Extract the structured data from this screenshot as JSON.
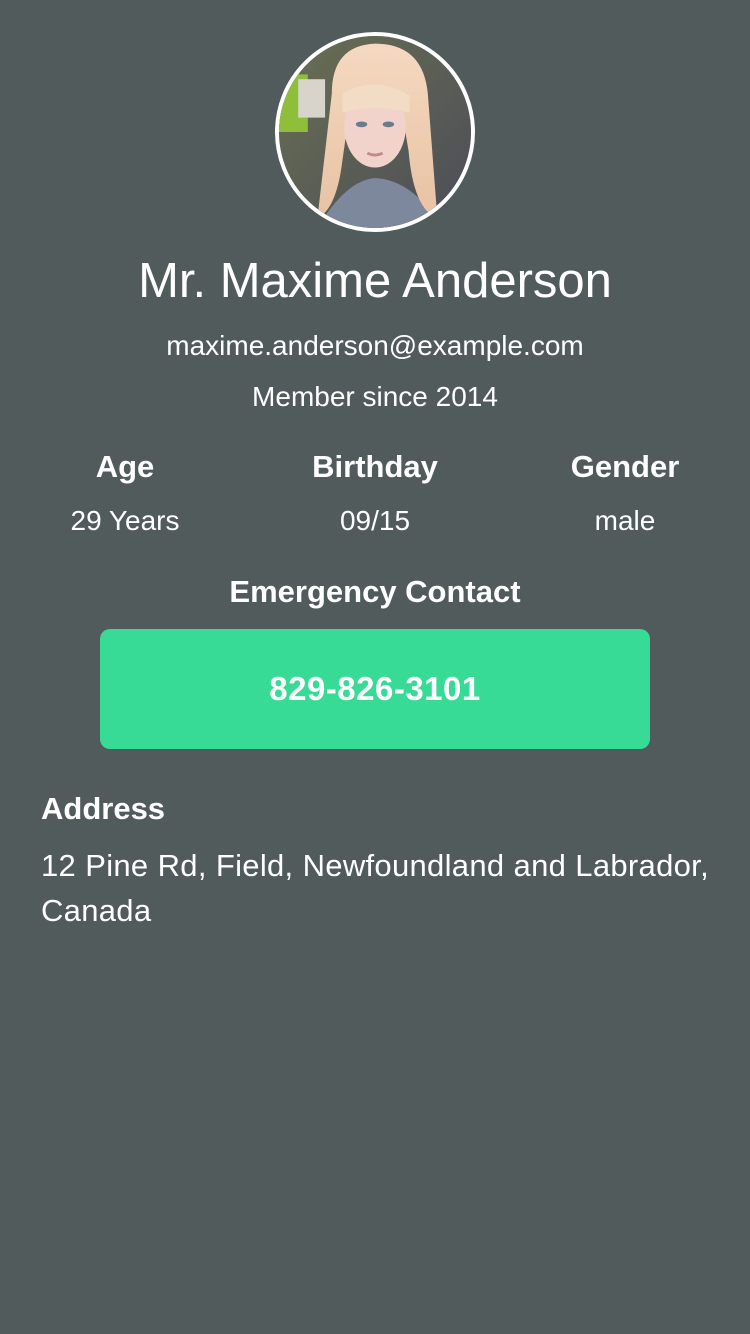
{
  "profile": {
    "avatar_icon": "user-photo",
    "name": "Mr. Maxime Anderson",
    "email": "maxime.anderson@example.com",
    "member_since": "Member since 2014"
  },
  "stats": [
    {
      "label": "Age",
      "value": "29 Years"
    },
    {
      "label": "Birthday",
      "value": "09/15"
    },
    {
      "label": "Gender",
      "value": "male"
    }
  ],
  "emergency": {
    "heading": "Emergency Contact",
    "phone": "829-826-3101"
  },
  "address": {
    "heading": "Address",
    "text": "12 Pine Rd, Field, Newfoundland and Labrador, Canada"
  },
  "colors": {
    "background": "#515b5b",
    "accent": "#38db95",
    "text": "#ffffff"
  }
}
